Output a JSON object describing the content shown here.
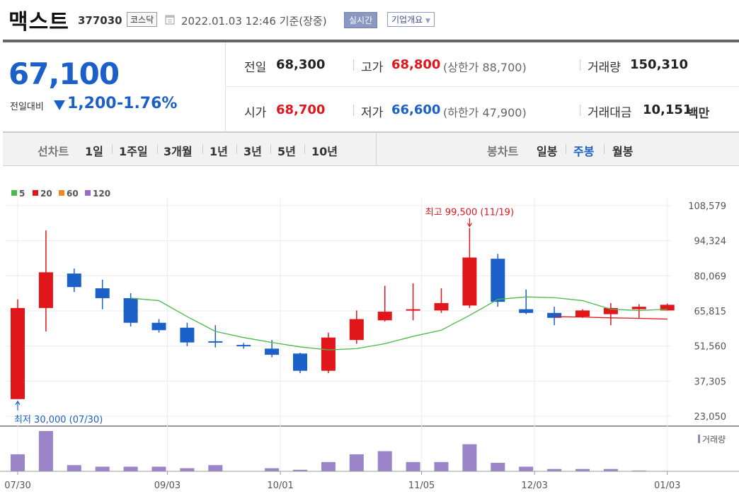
{
  "header": {
    "stock_name": "맥스트",
    "stock_code": "377030",
    "market": "코스닥",
    "quote_time": "2022.01.03 12:46  기준(장중)",
    "realtime_label": "실시간",
    "company_info_label": "기업개요"
  },
  "price": {
    "current": "67,100",
    "change_label": "전일대비",
    "change_amount": "1,200",
    "change_rate": "-1.76%"
  },
  "quote": {
    "prev_close_label": "전일",
    "prev_close": "68,300",
    "high_label": "고가",
    "high": "68,800",
    "upper_limit": "(상한가 88,700)",
    "volume_label": "거래량",
    "volume": "150,310",
    "open_label": "시가",
    "open": "68,700",
    "low_label": "저가",
    "low": "66,600",
    "lower_limit": "(하한가 47,900)",
    "value_label": "거래대금",
    "value": "10,151",
    "value_unit": "백만"
  },
  "toolbar": {
    "line_chart_label": "선차트",
    "periods": [
      "1일",
      "1주일",
      "3개월",
      "1년",
      "3년",
      "5년",
      "10년"
    ],
    "candle_chart_label": "봉차트",
    "candle_types": [
      "일봉",
      "주봉",
      "월봉"
    ],
    "active_candle": "주봉"
  },
  "colors": {
    "up": "#e0161a",
    "down": "#1b5fc9",
    "ma5": "#4cb84c",
    "ma20": "#e0161a",
    "ma60": "#f08a1c",
    "ma120": "#9b6cc7",
    "volume": "#9a85c8"
  },
  "chart_data": {
    "type": "candlestick",
    "legend": [
      "5",
      "20",
      "60",
      "120"
    ],
    "ylim": [
      23050,
      108579
    ],
    "y_ticks": [
      "108,579",
      "94,324",
      "80,069",
      "65,815",
      "51,560",
      "37,305",
      "23,050"
    ],
    "x_ticks": [
      "07/30",
      "09/03",
      "10/01",
      "11/05",
      "12/03",
      "01/03"
    ],
    "max_annotation": "최고 99,500 (11/19)",
    "min_annotation": "최저 30,000 (07/30)",
    "volume_label": "거래량",
    "candles": [
      {
        "o": 30000,
        "h": 70500,
        "l": 30000,
        "c": 67000
      },
      {
        "o": 67000,
        "h": 98500,
        "l": 57500,
        "c": 81500
      },
      {
        "o": 81000,
        "h": 83000,
        "l": 73500,
        "c": 75500
      },
      {
        "o": 75000,
        "h": 78500,
        "l": 66500,
        "c": 71000
      },
      {
        "o": 71000,
        "h": 73000,
        "l": 59500,
        "c": 61000
      },
      {
        "o": 61000,
        "h": 62500,
        "l": 57000,
        "c": 58000
      },
      {
        "o": 59000,
        "h": 61000,
        "l": 51500,
        "c": 53000
      },
      {
        "o": 53500,
        "h": 60000,
        "l": 51000,
        "c": 53300
      },
      {
        "o": 52000,
        "h": 52800,
        "l": 50500,
        "c": 51500
      },
      {
        "o": 50500,
        "h": 54000,
        "l": 47000,
        "c": 48000
      },
      {
        "o": 48500,
        "h": 48800,
        "l": 40500,
        "c": 41500
      },
      {
        "o": 41500,
        "h": 57000,
        "l": 40500,
        "c": 55000
      },
      {
        "o": 54000,
        "h": 66000,
        "l": 52500,
        "c": 62500
      },
      {
        "o": 62000,
        "h": 76000,
        "l": 61500,
        "c": 65500
      },
      {
        "o": 66300,
        "h": 77000,
        "l": 62000,
        "c": 66500
      },
      {
        "o": 66000,
        "h": 75000,
        "l": 65000,
        "c": 69000
      },
      {
        "o": 68000,
        "h": 99500,
        "l": 67000,
        "c": 87500
      },
      {
        "o": 87000,
        "h": 89000,
        "l": 67500,
        "c": 69500
      },
      {
        "o": 66500,
        "h": 74500,
        "l": 64500,
        "c": 65000
      },
      {
        "o": 65000,
        "h": 67500,
        "l": 60000,
        "c": 63000
      },
      {
        "o": 63500,
        "h": 66500,
        "l": 63000,
        "c": 66000
      },
      {
        "o": 64500,
        "h": 69000,
        "l": 60000,
        "c": 67000
      },
      {
        "o": 66500,
        "h": 68500,
        "l": 63000,
        "c": 67500
      },
      {
        "o": 66000,
        "h": 68800,
        "l": 66000,
        "c": 68300
      }
    ],
    "ma5": [
      null,
      null,
      null,
      null,
      71000,
      70000,
      63500,
      57500,
      55000,
      53000,
      51200,
      50000,
      50500,
      52500,
      55500,
      58000,
      64000,
      70500,
      71500,
      71200,
      70000,
      66500,
      66000,
      66500
    ],
    "ma20": [
      null,
      null,
      null,
      null,
      null,
      null,
      null,
      null,
      null,
      null,
      null,
      null,
      null,
      null,
      null,
      null,
      null,
      null,
      null,
      63500,
      63300,
      63000,
      62800,
      62500
    ],
    "volume": [
      22,
      52,
      8,
      6,
      6,
      6,
      4,
      8,
      0,
      4,
      2,
      12,
      22,
      26,
      12,
      12,
      35,
      11,
      6,
      3,
      3,
      3,
      1,
      0
    ],
    "volume_max": 52
  }
}
